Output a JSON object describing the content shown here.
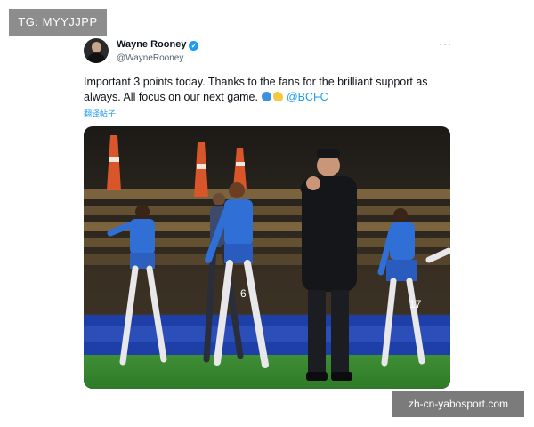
{
  "watermarks": {
    "top": "TG: MYYJJPP",
    "bottom": "zh-cn-yabosport.com"
  },
  "tweet": {
    "author_name": "Wayne Rooney",
    "author_handle": "@WayneRooney",
    "text_before": "Important 3 points today. Thanks to the fans for the brilliant support as always. All focus on our next game.",
    "mention": "@BCFC",
    "translate_label": "翻译帖子",
    "more_glyph": "···",
    "verified_glyph": "✓"
  },
  "photo": {
    "player_numbers": [
      "6",
      "17"
    ],
    "colors": {
      "kit_blue": "#2f6fd6",
      "coat_black": "#15161a",
      "pitch_green": "#3f8f35"
    }
  }
}
